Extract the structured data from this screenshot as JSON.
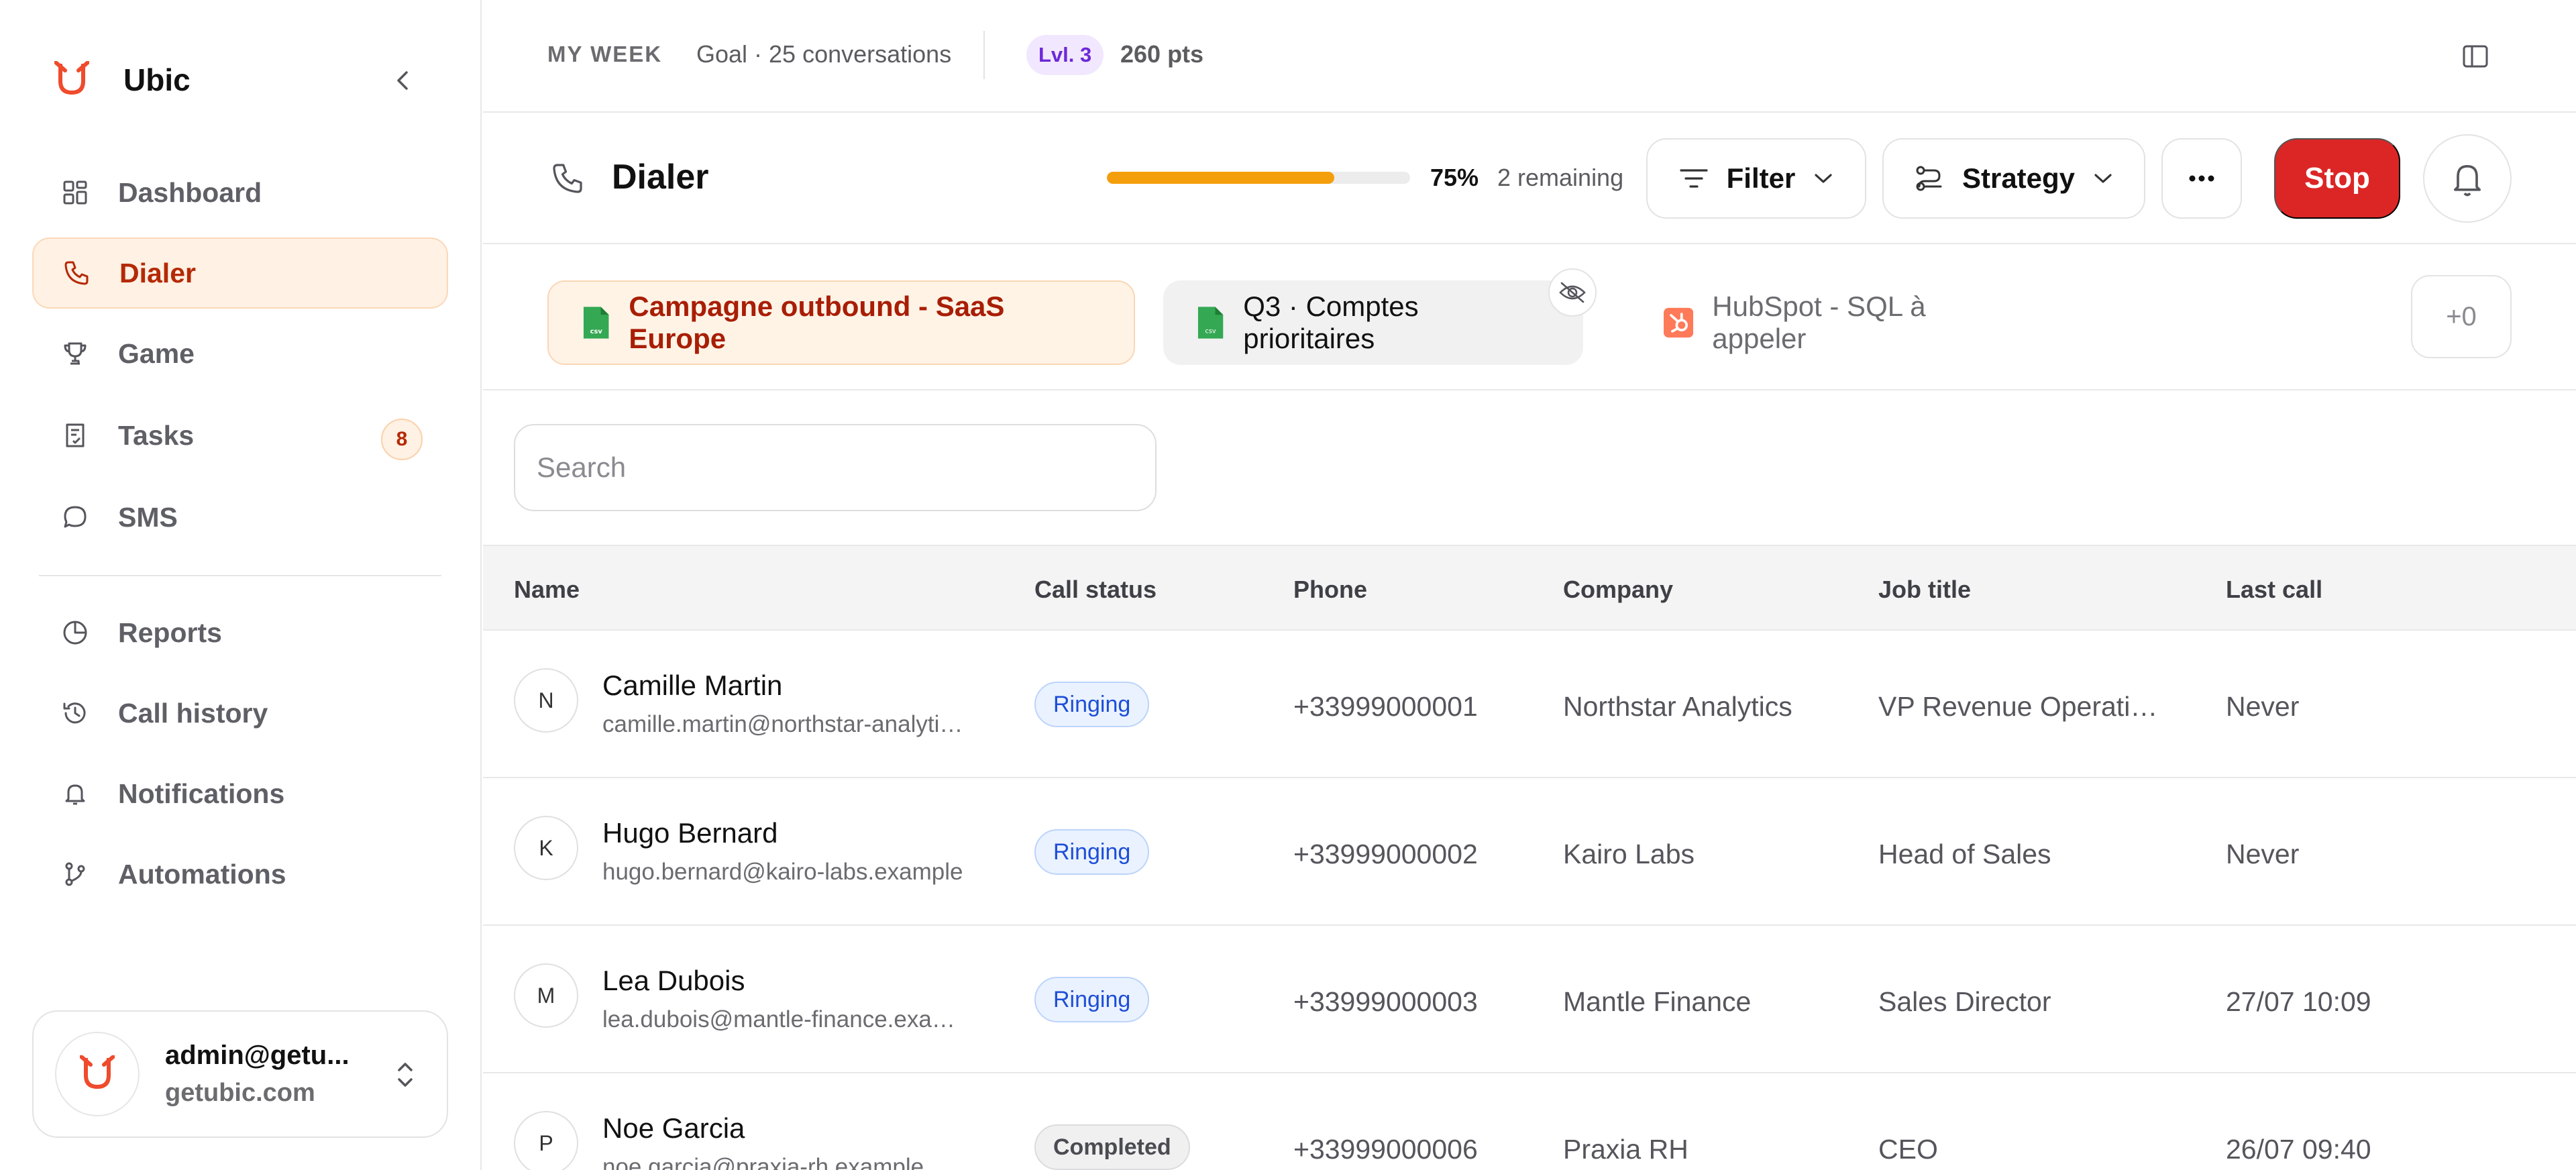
{
  "app": {
    "name": "Ubic",
    "brand_color": "#ef4b2c"
  },
  "sidebar": {
    "items": [
      {
        "label": "Dashboard",
        "icon": "dashboard-icon"
      },
      {
        "label": "Dialer",
        "icon": "phone-icon",
        "active": true
      },
      {
        "label": "Game",
        "icon": "trophy-icon"
      },
      {
        "label": "Tasks",
        "icon": "tasks-icon",
        "badge": "8"
      },
      {
        "label": "SMS",
        "icon": "chat-icon"
      },
      {
        "label": "Reports",
        "icon": "pie-chart-icon"
      },
      {
        "label": "Call history",
        "icon": "history-icon"
      },
      {
        "label": "Notifications",
        "icon": "bell-icon"
      },
      {
        "label": "Automations",
        "icon": "automation-icon"
      }
    ],
    "user": {
      "email": "admin@getu...",
      "domain": "getubic.com"
    }
  },
  "topbar": {
    "week_label": "MY WEEK",
    "goal": "Goal · 25 conversations",
    "level": "Lvl. 3",
    "points": "260 pts"
  },
  "dialer": {
    "title": "Dialer",
    "progress_percent": 75,
    "progress_label": "75%",
    "remaining": "2 remaining",
    "filter_label": "Filter",
    "strategy_label": "Strategy",
    "stop_label": "Stop",
    "accent": "#f59e0b",
    "stop_color": "#dc2626"
  },
  "lists": {
    "tabs": [
      {
        "label": "Campagne outbound - SaaS Europe",
        "icon": "csv-sheet-icon",
        "active": true
      },
      {
        "label": "Q3 · Comptes prioritaires",
        "icon": "csv-sheet-icon"
      },
      {
        "label": "HubSpot - SQL à appeler",
        "icon": "hubspot-icon"
      }
    ],
    "more": "+0"
  },
  "search": {
    "placeholder": "Search",
    "value": ""
  },
  "table": {
    "columns": [
      "Name",
      "Call status",
      "Phone",
      "Company",
      "Job title",
      "Last call"
    ],
    "rows": [
      {
        "initial": "N",
        "name": "Camille Martin",
        "email": "camille.martin@northstar-analytics.example",
        "status": "Ringing",
        "status_kind": "ringing",
        "phone": "+33999000001",
        "company": "Northstar Analytics",
        "job": "VP Revenue Operations",
        "last_call": "Never"
      },
      {
        "initial": "K",
        "name": "Hugo Bernard",
        "email": "hugo.bernard@kairo-labs.example",
        "status": "Ringing",
        "status_kind": "ringing",
        "phone": "+33999000002",
        "company": "Kairo Labs",
        "job": "Head of Sales",
        "last_call": "Never"
      },
      {
        "initial": "M",
        "name": "Lea Dubois",
        "email": "lea.dubois@mantle-finance.example",
        "status": "Ringing",
        "status_kind": "ringing",
        "phone": "+33999000003",
        "company": "Mantle Finance",
        "job": "Sales Director",
        "last_call": "27/07 10:09"
      },
      {
        "initial": "P",
        "name": "Noe Garcia",
        "email": "noe.garcia@praxia-rh.example",
        "status": "Completed",
        "status_kind": "completed",
        "phone": "+33999000006",
        "company": "Praxia RH",
        "job": "CEO",
        "last_call": "26/07 09:40"
      }
    ]
  }
}
